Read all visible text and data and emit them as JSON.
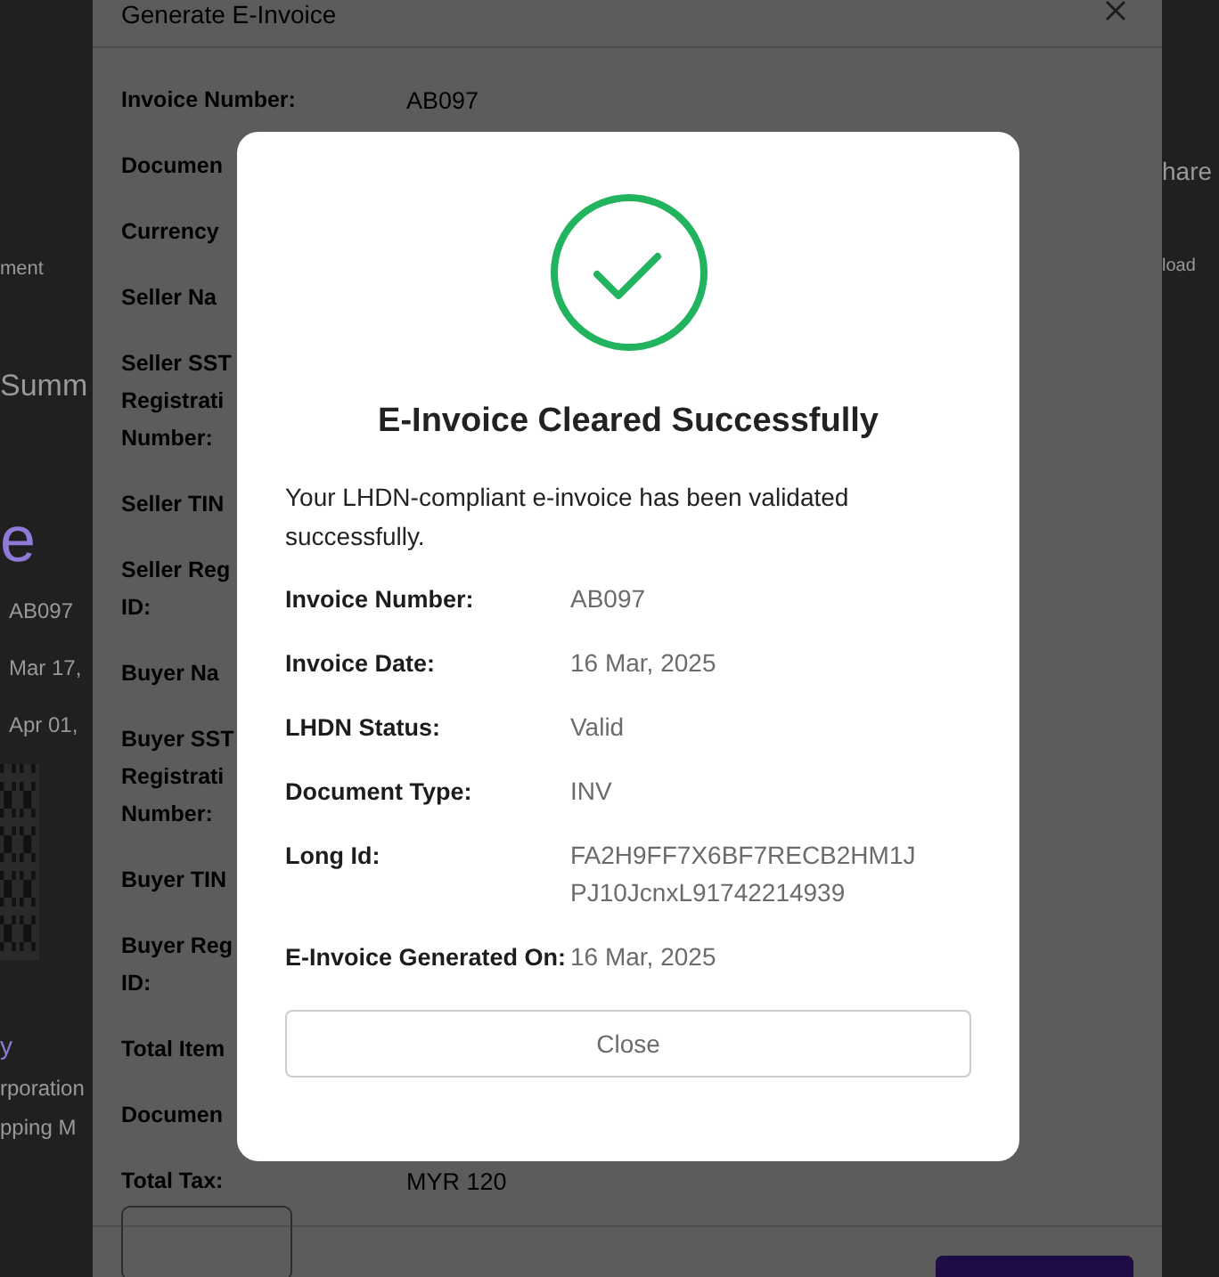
{
  "page": {
    "left_texts": [
      {
        "kind": "tab",
        "text": "ment"
      },
      {
        "kind": "heading",
        "text": "Summ"
      },
      {
        "kind": "big",
        "text": "e"
      },
      {
        "kind": "value",
        "text": "AB097"
      },
      {
        "kind": "value",
        "text": "Mar 17,"
      },
      {
        "kind": "value",
        "text": "Apr 01,"
      },
      {
        "kind": "qr"
      },
      {
        "kind": "link",
        "text": "y"
      },
      {
        "kind": "value",
        "text": "rporation"
      },
      {
        "kind": "value",
        "text": "pping M"
      }
    ],
    "right_texts": [
      {
        "kind": "heading",
        "text": "hare"
      },
      {
        "kind": "tab",
        "text": "load"
      }
    ]
  },
  "generate_dialog": {
    "title": "Generate E-Invoice",
    "fields": [
      {
        "label": "Invoice Number:",
        "value": "AB097"
      },
      {
        "label": "Documen"
      },
      {
        "label": "Currency"
      },
      {
        "label": "Seller Na"
      },
      {
        "label": "Seller SST\nRegistrati\nNumber:"
      },
      {
        "label": "Seller TIN"
      },
      {
        "label": "Seller Reg\nID:"
      },
      {
        "label": "Buyer Na"
      },
      {
        "label": "Buyer SST\nRegistrati\nNumber:"
      },
      {
        "label": "Buyer TIN"
      },
      {
        "label": "Buyer Reg\nID:"
      },
      {
        "label": "Total Item"
      },
      {
        "label": "Documen"
      },
      {
        "label": "Total Tax:",
        "value": "MYR 120"
      }
    ]
  },
  "success_modal": {
    "title": "E-Invoice Cleared Successfully",
    "message": "Your LHDN-compliant e-invoice has been validated successfully.",
    "fields": [
      {
        "label": "Invoice Number:",
        "value": "AB097"
      },
      {
        "label": "Invoice Date:",
        "value": "16 Mar, 2025"
      },
      {
        "label": "LHDN Status:",
        "value": "Valid"
      },
      {
        "label": "Document Type:",
        "value": "INV"
      },
      {
        "label": "Long Id:",
        "value": "FA2H9FF7X6BF7RECB2HM1JPJ10JcnxL91742214939"
      },
      {
        "label": "E-Invoice Generated On:",
        "value": "16 Mar, 2025"
      }
    ],
    "close_button": "Close"
  }
}
